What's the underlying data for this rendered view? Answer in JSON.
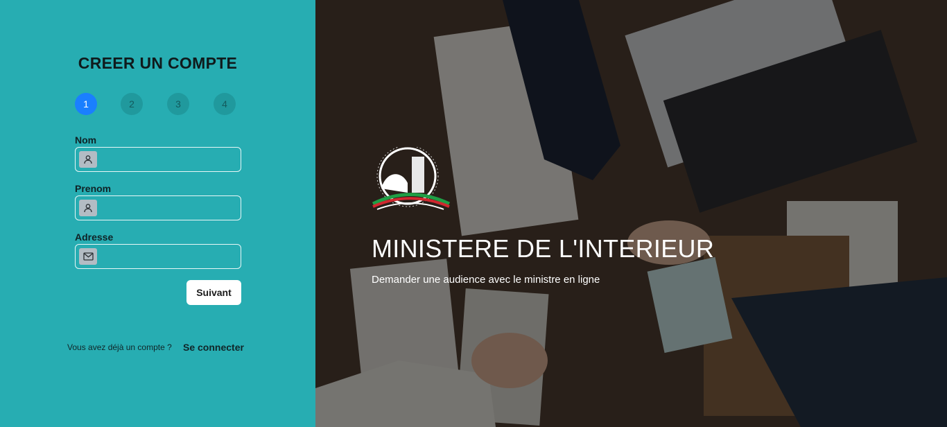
{
  "form": {
    "title": "CREER UN COMPTE",
    "steps": [
      "1",
      "2",
      "3",
      "4"
    ],
    "active_step": 1,
    "fields": [
      {
        "label": "Nom",
        "icon": "user-icon",
        "value": "",
        "placeholder": ""
      },
      {
        "label": "Prenom",
        "icon": "user-icon",
        "value": "",
        "placeholder": ""
      },
      {
        "label": "Adresse",
        "icon": "mail-icon",
        "value": "",
        "placeholder": ""
      }
    ],
    "next_button": "Suivant",
    "login_question": "Vous avez déjà un compte ?",
    "login_link": "Se connecter"
  },
  "hero": {
    "title": "MINISTERE DE L'INTERIEUR",
    "subtitle": "Demander une audience avec le ministre en ligne"
  },
  "colors": {
    "panel_bg": "#27adb2",
    "active_step": "#1a7fff",
    "inactive_step": "#20999d",
    "button_bg": "#ffffff"
  }
}
